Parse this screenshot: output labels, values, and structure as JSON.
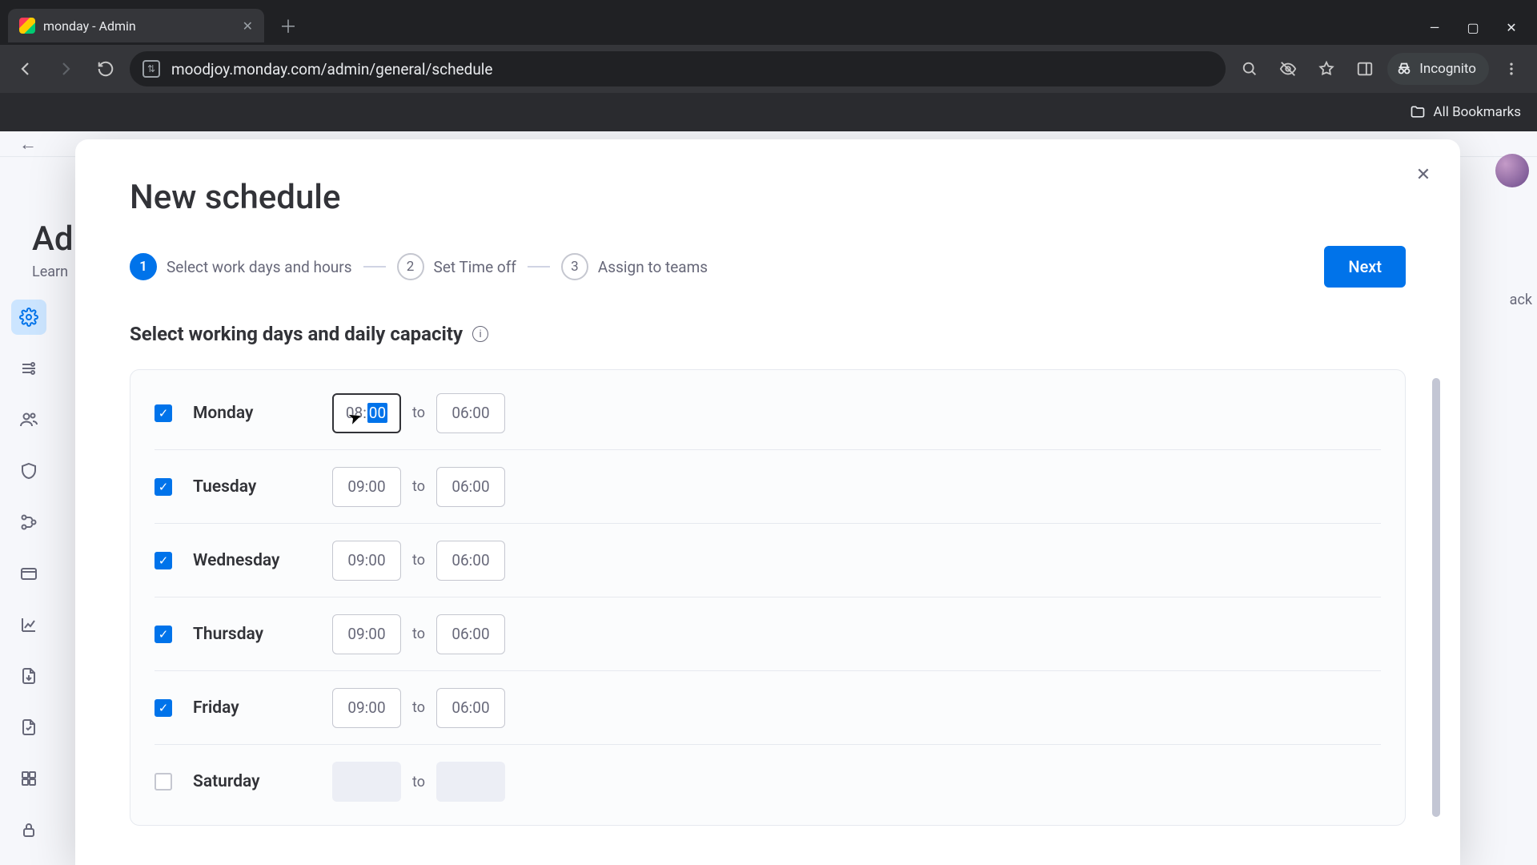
{
  "browser": {
    "tab_title": "monday - Admin",
    "url": "moodjoy.monday.com/admin/general/schedule",
    "incognito_label": "Incognito",
    "bookmarks_label": "All Bookmarks"
  },
  "background": {
    "title_partial": "Ad",
    "subtitle_partial": "Learn",
    "feedback_partial": "ack"
  },
  "modal": {
    "title": "New schedule",
    "close_label": "✕",
    "next_label": "Next",
    "section_title": "Select working days and daily capacity",
    "steps": [
      {
        "num": "1",
        "label": "Select work days and hours",
        "active": true
      },
      {
        "num": "2",
        "label": "Set Time off",
        "active": false
      },
      {
        "num": "3",
        "label": "Assign to teams",
        "active": false
      }
    ],
    "to_label": "to",
    "days": [
      {
        "name": "Monday",
        "checked": true,
        "start_hour": "08",
        "start_min": "00",
        "end": "06:00",
        "focused": true
      },
      {
        "name": "Tuesday",
        "checked": true,
        "start": "09:00",
        "end": "06:00"
      },
      {
        "name": "Wednesday",
        "checked": true,
        "start": "09:00",
        "end": "06:00"
      },
      {
        "name": "Thursday",
        "checked": true,
        "start": "09:00",
        "end": "06:00"
      },
      {
        "name": "Friday",
        "checked": true,
        "start": "09:00",
        "end": "06:00"
      },
      {
        "name": "Saturday",
        "checked": false
      }
    ]
  }
}
